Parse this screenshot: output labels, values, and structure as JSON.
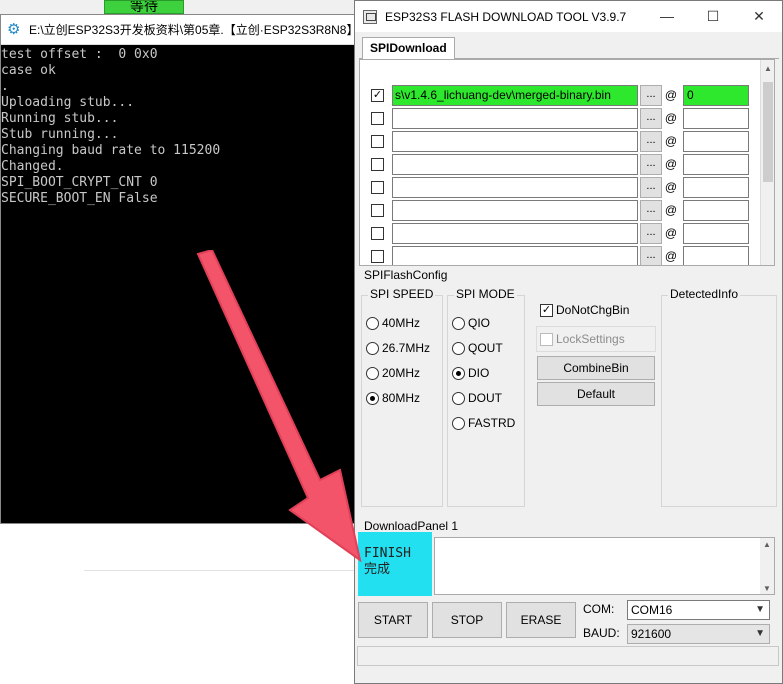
{
  "background": {
    "green_button_label": "等待"
  },
  "console": {
    "title": "E:\\立创ESP32S3开发板资料\\第05章.【立创·ESP32S3R8N8】",
    "lines": [
      "test offset :  0 0x0",
      "case ok",
      ".",
      "Uploading stub...",
      "Running stub...",
      "Stub running...",
      "Changing baud rate to 115200",
      "Changed.",
      "SPI_BOOT_CRYPT_CNT 0",
      "SECURE_BOOT_EN False"
    ]
  },
  "tool": {
    "title": "ESP32S3 FLASH DOWNLOAD TOOL V3.9.7",
    "minimize": "—",
    "maximize": "☐",
    "close": "✕",
    "tab": "SPIDownload",
    "files": [
      {
        "checked": true,
        "path": "s\\v1.4.6_lichuang-dev\\merged-binary.bin",
        "offset": "0",
        "highlight": true
      },
      {
        "checked": false,
        "path": "",
        "offset": "",
        "highlight": false
      },
      {
        "checked": false,
        "path": "",
        "offset": "",
        "highlight": false
      },
      {
        "checked": false,
        "path": "",
        "offset": "",
        "highlight": false
      },
      {
        "checked": false,
        "path": "",
        "offset": "",
        "highlight": false
      },
      {
        "checked": false,
        "path": "",
        "offset": "",
        "highlight": false
      },
      {
        "checked": false,
        "path": "",
        "offset": "",
        "highlight": false
      },
      {
        "checked": false,
        "path": "",
        "offset": "",
        "highlight": false
      }
    ],
    "browse_label": "...",
    "at_label": "@",
    "spi_flash_config": "SPIFlashConfig",
    "spi_speed": {
      "title": "SPI SPEED",
      "options": [
        "40MHz",
        "26.7MHz",
        "20MHz",
        "80MHz"
      ],
      "selected": 3
    },
    "spi_mode": {
      "title": "SPI MODE",
      "options": [
        "QIO",
        "QOUT",
        "DIO",
        "DOUT",
        "FASTRD"
      ],
      "selected": 2
    },
    "do_not_chg_bin": {
      "label": "DoNotChgBin",
      "checked": true
    },
    "lock_settings": {
      "label": "LockSettings",
      "checked": false
    },
    "combine_bin": "CombineBin",
    "default": "Default",
    "detected_info": "DetectedInfo",
    "download_panel": "DownloadPanel 1",
    "finish_line1": "FINISH",
    "finish_line2": "完成",
    "start": "START",
    "stop": "STOP",
    "erase": "ERASE",
    "com_label": "COM:",
    "com_value": "COM16",
    "baud_label": "BAUD:",
    "baud_value": "921600",
    "colors": {
      "highlight_green": "#2ee82e",
      "finish_cyan": "#22e0f0",
      "arrow_red": "#f4546a"
    }
  }
}
